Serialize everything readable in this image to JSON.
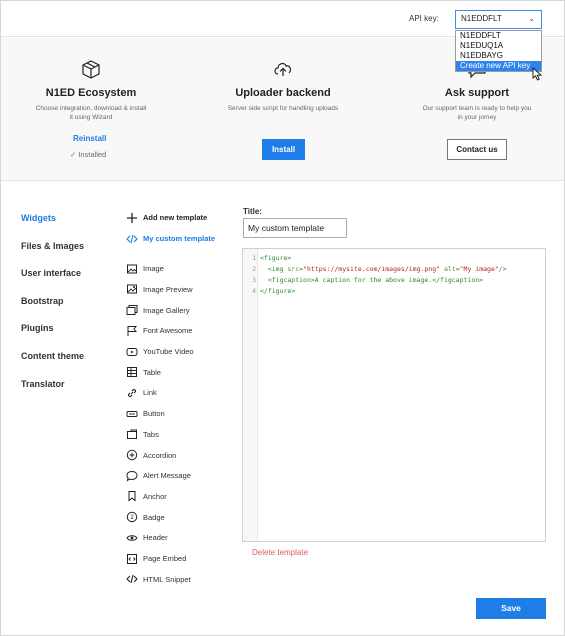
{
  "header": {
    "api_key_label": "API key:",
    "api_key_selected": "N1EDDFLT",
    "api_key_options": [
      "N1EDDFLT",
      "N1EDUQ1A",
      "N1EDBAYG",
      "Create new API key"
    ],
    "highlighted_option": "Create new API key"
  },
  "hero": {
    "cards": [
      {
        "icon": "box-icon",
        "title": "N1ED Ecosystem",
        "desc_line1": "Choose integration, download & install",
        "desc_line2": "it using Wizard"
      },
      {
        "icon": "cloud-upload-icon",
        "title": "Uploader backend",
        "desc_line1": "Server side script for handling uploads",
        "desc_line2": ""
      },
      {
        "icon": "chat-bubble-icon",
        "title": "Ask support",
        "desc_line1": "Our support team is ready to help you",
        "desc_line2": "in your jomey"
      }
    ],
    "reinstall_label": "Reinstall",
    "installed_label": "Installed",
    "install_button": "Install",
    "contact_button": "Contact us"
  },
  "nav": {
    "items": [
      "Widgets",
      "Files & Images",
      "User interface",
      "Bootstrap",
      "Plugins",
      "Content theme",
      "Translator"
    ],
    "active": "Widgets"
  },
  "widgets": {
    "add_label": "Add new template",
    "custom_label": "My custom template",
    "items": [
      {
        "label": "Image",
        "icon": "image-icon"
      },
      {
        "label": "Image Preview",
        "icon": "image-preview-icon"
      },
      {
        "label": "Image Gallery",
        "icon": "image-gallery-icon"
      },
      {
        "label": "Font Awesome",
        "icon": "flag-icon"
      },
      {
        "label": "YouTube Video",
        "icon": "youtube-icon"
      },
      {
        "label": "Table",
        "icon": "table-icon"
      },
      {
        "label": "Link",
        "icon": "link-icon"
      },
      {
        "label": "Button",
        "icon": "button-icon"
      },
      {
        "label": "Tabs",
        "icon": "tabs-icon"
      },
      {
        "label": "Accordion",
        "icon": "accordion-icon"
      },
      {
        "label": "Alert Message",
        "icon": "speech-bubble-icon"
      },
      {
        "label": "Anchor",
        "icon": "bookmark-icon"
      },
      {
        "label": "Badge",
        "icon": "badge-icon"
      },
      {
        "label": "Header",
        "icon": "eye-icon"
      },
      {
        "label": "Page Embed",
        "icon": "embed-icon"
      },
      {
        "label": "HTML Snippet",
        "icon": "code-icon"
      }
    ]
  },
  "editor": {
    "title_label": "Title:",
    "title_value": "My custom template",
    "line_numbers": [
      "1",
      "2",
      "3",
      "4"
    ],
    "code_lines": [
      "<figure>",
      "  <img src=\"https://mysite.com/images/img.png\" alt=\"My image\"/>",
      "  <figcaption>A caption for the above image.</figcaption>",
      "</figure>"
    ],
    "delete_label": "Delete template",
    "save_label": "Save"
  }
}
